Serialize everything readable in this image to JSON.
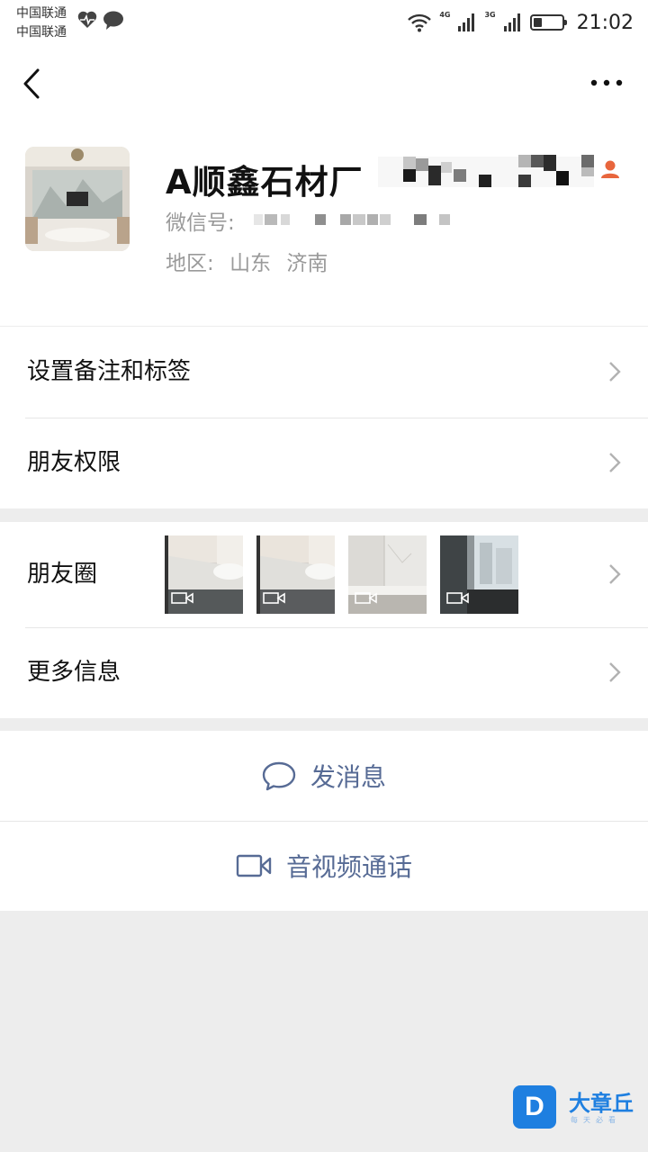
{
  "status_bar": {
    "carrier_1": "中国联通",
    "carrier_2": "中国联通",
    "net_1": "4G",
    "net_2": "3G",
    "battery_level": 0.4,
    "time": "21:02"
  },
  "profile": {
    "name": "A顺鑫石材厂",
    "wechat_id_label": "微信号:",
    "region_label": "地区:",
    "region_province": "山东",
    "region_city": "济南"
  },
  "menu": {
    "remarks_label": "设置备注和标签",
    "permissions_label": "朋友权限",
    "moments_label": "朋友圈",
    "more_info_label": "更多信息"
  },
  "actions": {
    "message_label": "发消息",
    "call_label": "音视频通话"
  },
  "colors": {
    "link": "#576b95",
    "background": "#ededed",
    "gender_icon": "#e8663d"
  },
  "watermark": {
    "logo_letter": "D",
    "title": "大章丘",
    "subtitle": "每天必看"
  }
}
